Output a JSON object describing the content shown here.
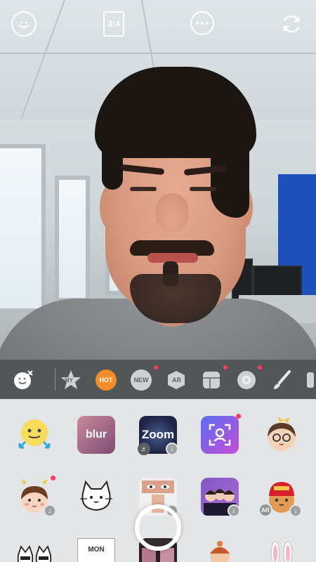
{
  "top_bar": {
    "aspect_ratio": "3:4",
    "icons": [
      "sticker-home-icon",
      "more-icon",
      "switch-camera-icon"
    ]
  },
  "categories": [
    {
      "key": "reset",
      "label": ""
    },
    {
      "key": "my",
      "label": "MY"
    },
    {
      "key": "hot",
      "label": "HOT"
    },
    {
      "key": "new",
      "label": "NEW"
    },
    {
      "key": "ar",
      "label": "AR"
    },
    {
      "key": "frames",
      "label": ""
    },
    {
      "key": "beauty",
      "label": ""
    },
    {
      "key": "art",
      "label": ""
    }
  ],
  "stickers": {
    "row1": [
      {
        "name": "face-swap",
        "label": ""
      },
      {
        "name": "blur",
        "label": "blur"
      },
      {
        "name": "zoom",
        "label": "Zoom"
      },
      {
        "name": "face-frame",
        "label": ""
      },
      {
        "name": "glasses-girl",
        "label": ""
      }
    ],
    "row2": [
      {
        "name": "cute-girl",
        "label": ""
      },
      {
        "name": "white-cat",
        "label": ""
      },
      {
        "name": "eyes-card",
        "label": ""
      },
      {
        "name": "trio-photo",
        "label": ""
      },
      {
        "name": "red-cap-cat",
        "label": "AR"
      }
    ],
    "row3": [
      {
        "name": "cat-twins",
        "label": ""
      },
      {
        "name": "museum",
        "label": "MON"
      },
      {
        "name": "photo-strip",
        "label": ""
      },
      {
        "name": "snow-man",
        "label": ""
      },
      {
        "name": "bunny-ears",
        "label": ""
      }
    ]
  }
}
